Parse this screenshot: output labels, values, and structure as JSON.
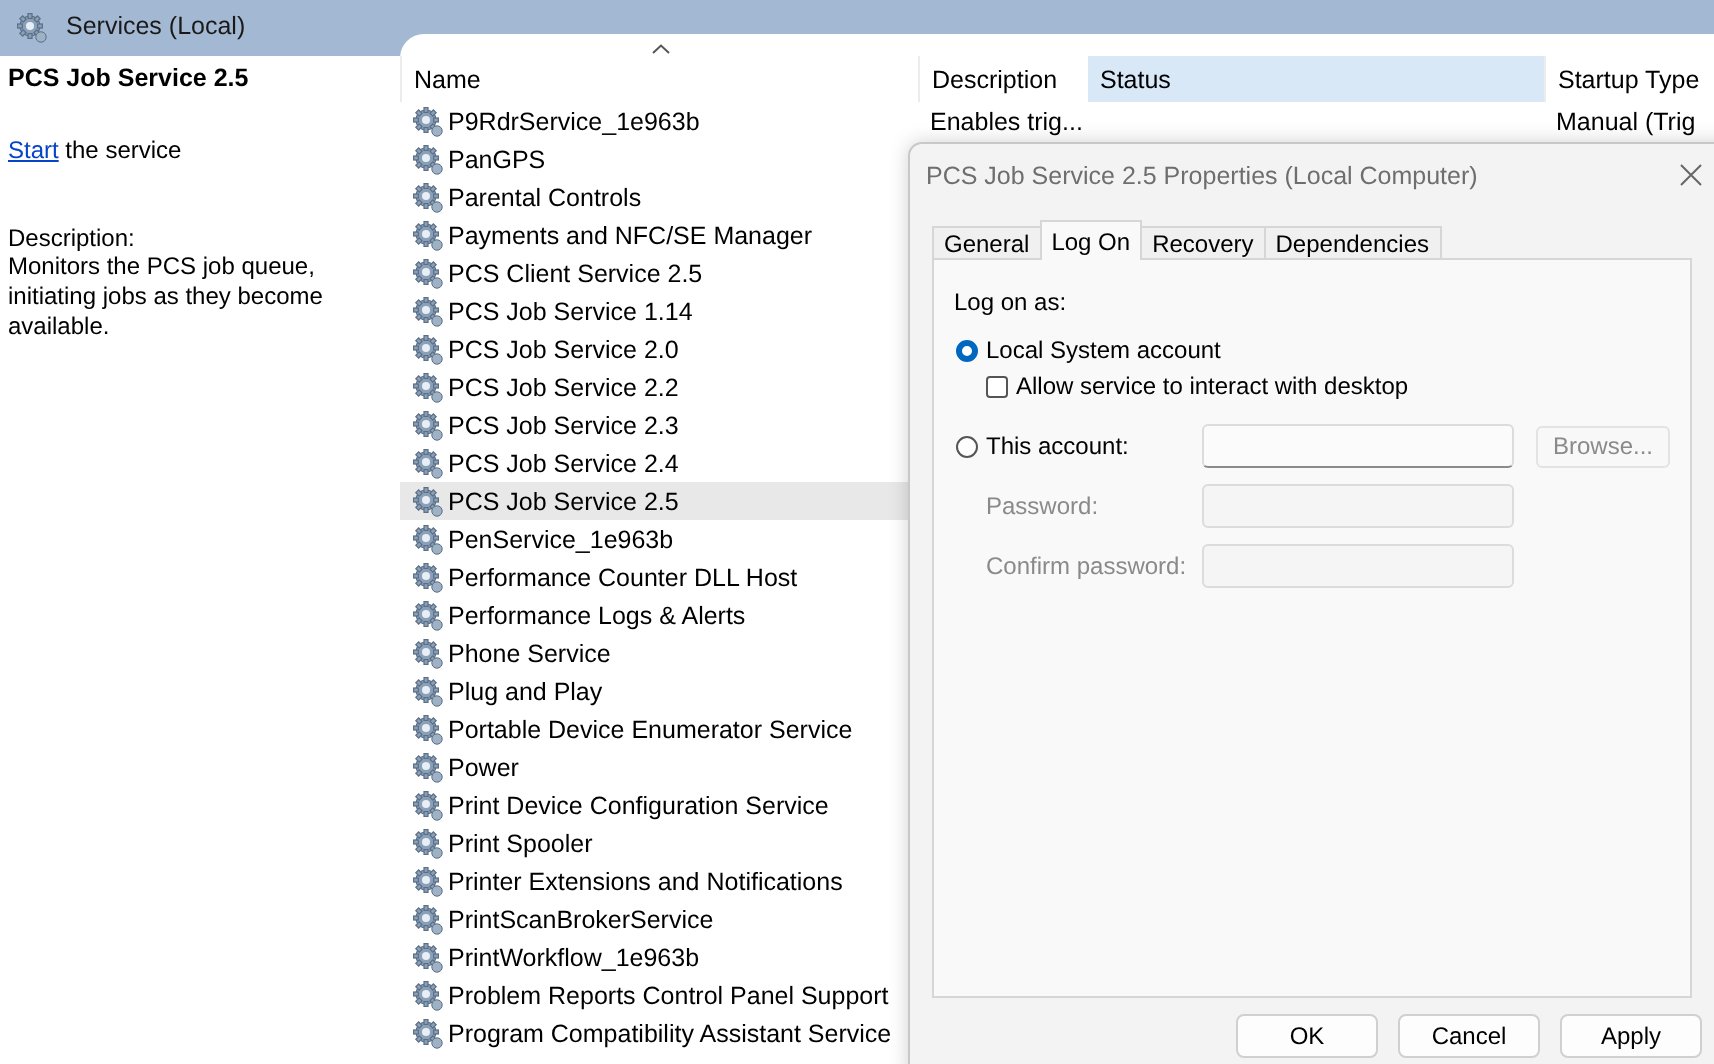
{
  "window": {
    "title": "Services (Local)"
  },
  "details": {
    "heading": "PCS Job Service 2.5",
    "link": "Start",
    "link_rest": " the service",
    "description_label": "Description:",
    "description": "Monitors the PCS job queue, initiating jobs as they become available."
  },
  "columns": [
    {
      "label": "Name",
      "selected": false,
      "sorted": true
    },
    {
      "label": "Description",
      "selected": false,
      "sorted": false
    },
    {
      "label": "Status",
      "selected": true,
      "sorted": false
    },
    {
      "label": "Startup Type",
      "selected": false,
      "sorted": false
    }
  ],
  "rows": [
    {
      "name": "P9RdrService_1e963b",
      "description": "Enables trig...",
      "startup_type": "Manual (Trig",
      "selected": false
    },
    {
      "name": "PanGPS",
      "selected": false
    },
    {
      "name": "Parental Controls",
      "selected": false
    },
    {
      "name": "Payments and NFC/SE Manager",
      "selected": false
    },
    {
      "name": "PCS Client Service 2.5",
      "selected": false
    },
    {
      "name": "PCS Job Service 1.14",
      "selected": false
    },
    {
      "name": "PCS Job Service 2.0",
      "selected": false
    },
    {
      "name": "PCS Job Service 2.2",
      "selected": false
    },
    {
      "name": "PCS Job Service 2.3",
      "selected": false
    },
    {
      "name": "PCS Job Service 2.4",
      "selected": false
    },
    {
      "name": "PCS Job Service 2.5",
      "selected": true
    },
    {
      "name": "PenService_1e963b",
      "selected": false
    },
    {
      "name": "Performance Counter DLL Host",
      "selected": false
    },
    {
      "name": "Performance Logs & Alerts",
      "selected": false
    },
    {
      "name": "Phone Service",
      "selected": false
    },
    {
      "name": "Plug and Play",
      "selected": false
    },
    {
      "name": "Portable Device Enumerator Service",
      "selected": false
    },
    {
      "name": "Power",
      "selected": false
    },
    {
      "name": "Print Device Configuration Service",
      "selected": false
    },
    {
      "name": "Print Spooler",
      "selected": false
    },
    {
      "name": "Printer Extensions and Notifications",
      "selected": false
    },
    {
      "name": "PrintScanBrokerService",
      "selected": false
    },
    {
      "name": "PrintWorkflow_1e963b",
      "selected": false
    },
    {
      "name": "Problem Reports Control Panel Support",
      "selected": false
    },
    {
      "name": "Program Compatibility Assistant Service",
      "selected": false
    }
  ],
  "dialog": {
    "title": "PCS Job Service 2.5 Properties (Local Computer)",
    "tabs": [
      {
        "label": "General",
        "selected": false
      },
      {
        "label": "Log On",
        "selected": true
      },
      {
        "label": "Recovery",
        "selected": false
      },
      {
        "label": "Dependencies",
        "selected": false
      }
    ],
    "logon_label": "Log on as:",
    "local_system": {
      "label": "Local System account",
      "selected": true
    },
    "interact": {
      "label": "Allow service to interact with desktop",
      "checked": false
    },
    "this_account": {
      "label": "This account:",
      "selected": false
    },
    "browse": {
      "label": "Browse...",
      "disabled": true
    },
    "password": {
      "label": "Password:",
      "disabled": true
    },
    "confirm_password": {
      "label": "Confirm password:",
      "disabled": true
    },
    "buttons": [
      "OK",
      "Cancel",
      "Apply"
    ]
  }
}
